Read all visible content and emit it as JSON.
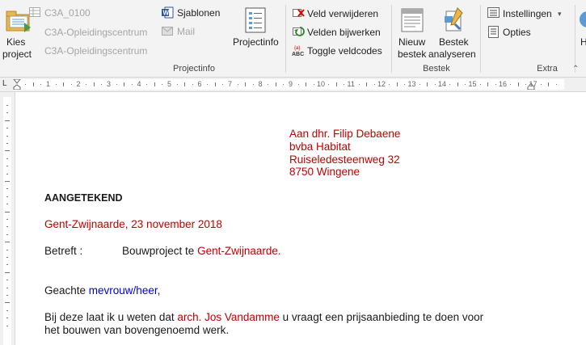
{
  "ribbon": {
    "kies_project": {
      "line1": "Kies",
      "line2": "project"
    },
    "project_fields": [
      "C3A_0100",
      "C3A-Opleidingscentrum",
      "C3A-Opleidingscentrum"
    ],
    "sjablonen": "Sjablonen",
    "mail": "Mail",
    "projectinfo_btn": "Projectinfo",
    "projectinfo_group": "Projectinfo",
    "veld_verwijderen": "Veld verwijderen",
    "velden_bijwerken": "Velden bijwerken",
    "toggle_veldcodes": "Toggle veldcodes",
    "nieuw_bestek": {
      "line1": "Nieuw",
      "line2": "bestek"
    },
    "bestek_analyseren": {
      "line1": "Bestek",
      "line2": "analyseren"
    },
    "bestek_group": "Bestek",
    "instellingen": "Instellingen",
    "opties": "Opties",
    "extra_group": "Extra",
    "help_partial": "H"
  },
  "ruler": {
    "ticks": [
      "1",
      "2",
      "3",
      "4",
      "5",
      "6",
      "7",
      "8",
      "9",
      "10",
      "11",
      "12",
      "13",
      "14",
      "15",
      "16",
      "17"
    ]
  },
  "document": {
    "address": [
      "Aan dhr. Filip Debaene",
      "bvba Habitat",
      "Ruiseledesteenweg 32",
      "8750 Wingene"
    ],
    "aangetekend": "AANGETEKEND",
    "place_date": "Gent-Zwijnaarde, 23 november 2018",
    "betreft_label": "Betreft :",
    "betreft_text": "Bouwproject te ",
    "betreft_place": "Gent-Zwijnaarde.",
    "greeting_prefix": "Geachte ",
    "greeting_field": "mevrouw/heer",
    "greeting_suffix": ",",
    "body1_a": "Bij deze laat ik u weten dat ",
    "body1_field": "arch. Jos Vandamme",
    "body1_b": " u vraagt een prijsaanbieding te doen voor",
    "body2": "het bouwen van bovengenoemd werk."
  },
  "colors": {
    "field_red": "#c00000",
    "field_blue": "#0000dd",
    "ribbon_bg": "#f3f3f3"
  }
}
